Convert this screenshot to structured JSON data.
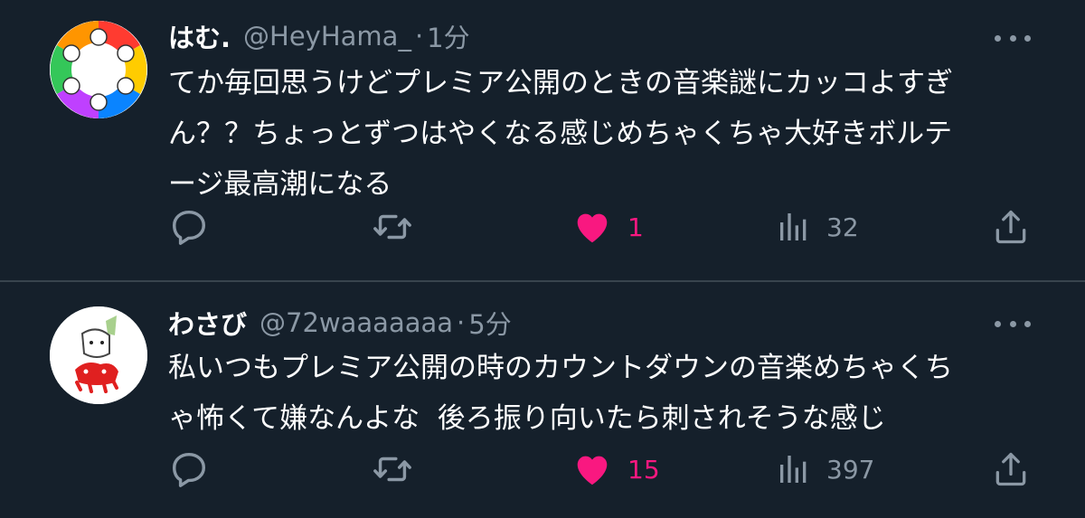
{
  "colors": {
    "background": "#15202b",
    "text": "#ffffff",
    "secondary_text": "#8b98a5",
    "divider": "#38444d",
    "like_active": "#f91880"
  },
  "tweets": [
    {
      "name": "はむ.",
      "handle": "@HeyHama_",
      "separator": "·",
      "time": "1分",
      "text_lines": [
        "てか毎回思うけどプレミア公開のときの音楽謎にカッコよすぎ",
        "ん？？ちょっとずつはやくなる感じめちゃくちゃ大好きボルテ",
        "ージ最高潮になる"
      ],
      "reply_icon": "reply-icon",
      "retweet_icon": "retweet-icon",
      "like_icon": "heart-filled-icon",
      "likes": "1",
      "views_icon": "views-icon",
      "views": "32",
      "share_icon": "share-icon",
      "liked": true
    },
    {
      "name": "わさび",
      "handle": "@72waaaaaaa",
      "separator": "·",
      "time": "5分",
      "text_lines": [
        "私いつもプレミア公開の時のカウントダウンの音楽めちゃくち",
        "ゃ怖くて嫌なんよな  後ろ振り向いたら刺されそうな感じ"
      ],
      "reply_icon": "reply-icon",
      "retweet_icon": "retweet-icon",
      "like_icon": "heart-filled-icon",
      "likes": "15",
      "views_icon": "views-icon",
      "views": "397",
      "share_icon": "share-icon",
      "liked": true
    }
  ]
}
